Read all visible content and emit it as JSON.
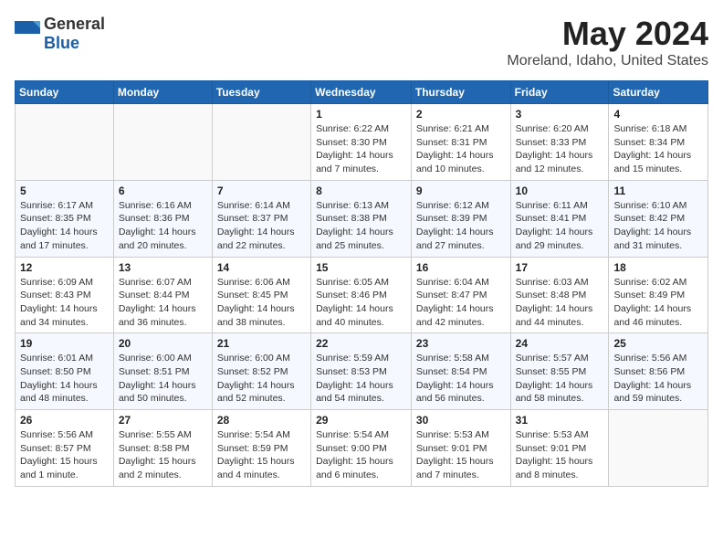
{
  "header": {
    "logo_general": "General",
    "logo_blue": "Blue",
    "title": "May 2024",
    "subtitle": "Moreland, Idaho, United States"
  },
  "days_of_week": [
    "Sunday",
    "Monday",
    "Tuesday",
    "Wednesday",
    "Thursday",
    "Friday",
    "Saturday"
  ],
  "weeks": [
    [
      {
        "num": "",
        "info": ""
      },
      {
        "num": "",
        "info": ""
      },
      {
        "num": "",
        "info": ""
      },
      {
        "num": "1",
        "info": "Sunrise: 6:22 AM\nSunset: 8:30 PM\nDaylight: 14 hours\nand 7 minutes."
      },
      {
        "num": "2",
        "info": "Sunrise: 6:21 AM\nSunset: 8:31 PM\nDaylight: 14 hours\nand 10 minutes."
      },
      {
        "num": "3",
        "info": "Sunrise: 6:20 AM\nSunset: 8:33 PM\nDaylight: 14 hours\nand 12 minutes."
      },
      {
        "num": "4",
        "info": "Sunrise: 6:18 AM\nSunset: 8:34 PM\nDaylight: 14 hours\nand 15 minutes."
      }
    ],
    [
      {
        "num": "5",
        "info": "Sunrise: 6:17 AM\nSunset: 8:35 PM\nDaylight: 14 hours\nand 17 minutes."
      },
      {
        "num": "6",
        "info": "Sunrise: 6:16 AM\nSunset: 8:36 PM\nDaylight: 14 hours\nand 20 minutes."
      },
      {
        "num": "7",
        "info": "Sunrise: 6:14 AM\nSunset: 8:37 PM\nDaylight: 14 hours\nand 22 minutes."
      },
      {
        "num": "8",
        "info": "Sunrise: 6:13 AM\nSunset: 8:38 PM\nDaylight: 14 hours\nand 25 minutes."
      },
      {
        "num": "9",
        "info": "Sunrise: 6:12 AM\nSunset: 8:39 PM\nDaylight: 14 hours\nand 27 minutes."
      },
      {
        "num": "10",
        "info": "Sunrise: 6:11 AM\nSunset: 8:41 PM\nDaylight: 14 hours\nand 29 minutes."
      },
      {
        "num": "11",
        "info": "Sunrise: 6:10 AM\nSunset: 8:42 PM\nDaylight: 14 hours\nand 31 minutes."
      }
    ],
    [
      {
        "num": "12",
        "info": "Sunrise: 6:09 AM\nSunset: 8:43 PM\nDaylight: 14 hours\nand 34 minutes."
      },
      {
        "num": "13",
        "info": "Sunrise: 6:07 AM\nSunset: 8:44 PM\nDaylight: 14 hours\nand 36 minutes."
      },
      {
        "num": "14",
        "info": "Sunrise: 6:06 AM\nSunset: 8:45 PM\nDaylight: 14 hours\nand 38 minutes."
      },
      {
        "num": "15",
        "info": "Sunrise: 6:05 AM\nSunset: 8:46 PM\nDaylight: 14 hours\nand 40 minutes."
      },
      {
        "num": "16",
        "info": "Sunrise: 6:04 AM\nSunset: 8:47 PM\nDaylight: 14 hours\nand 42 minutes."
      },
      {
        "num": "17",
        "info": "Sunrise: 6:03 AM\nSunset: 8:48 PM\nDaylight: 14 hours\nand 44 minutes."
      },
      {
        "num": "18",
        "info": "Sunrise: 6:02 AM\nSunset: 8:49 PM\nDaylight: 14 hours\nand 46 minutes."
      }
    ],
    [
      {
        "num": "19",
        "info": "Sunrise: 6:01 AM\nSunset: 8:50 PM\nDaylight: 14 hours\nand 48 minutes."
      },
      {
        "num": "20",
        "info": "Sunrise: 6:00 AM\nSunset: 8:51 PM\nDaylight: 14 hours\nand 50 minutes."
      },
      {
        "num": "21",
        "info": "Sunrise: 6:00 AM\nSunset: 8:52 PM\nDaylight: 14 hours\nand 52 minutes."
      },
      {
        "num": "22",
        "info": "Sunrise: 5:59 AM\nSunset: 8:53 PM\nDaylight: 14 hours\nand 54 minutes."
      },
      {
        "num": "23",
        "info": "Sunrise: 5:58 AM\nSunset: 8:54 PM\nDaylight: 14 hours\nand 56 minutes."
      },
      {
        "num": "24",
        "info": "Sunrise: 5:57 AM\nSunset: 8:55 PM\nDaylight: 14 hours\nand 58 minutes."
      },
      {
        "num": "25",
        "info": "Sunrise: 5:56 AM\nSunset: 8:56 PM\nDaylight: 14 hours\nand 59 minutes."
      }
    ],
    [
      {
        "num": "26",
        "info": "Sunrise: 5:56 AM\nSunset: 8:57 PM\nDaylight: 15 hours\nand 1 minute."
      },
      {
        "num": "27",
        "info": "Sunrise: 5:55 AM\nSunset: 8:58 PM\nDaylight: 15 hours\nand 2 minutes."
      },
      {
        "num": "28",
        "info": "Sunrise: 5:54 AM\nSunset: 8:59 PM\nDaylight: 15 hours\nand 4 minutes."
      },
      {
        "num": "29",
        "info": "Sunrise: 5:54 AM\nSunset: 9:00 PM\nDaylight: 15 hours\nand 6 minutes."
      },
      {
        "num": "30",
        "info": "Sunrise: 5:53 AM\nSunset: 9:01 PM\nDaylight: 15 hours\nand 7 minutes."
      },
      {
        "num": "31",
        "info": "Sunrise: 5:53 AM\nSunset: 9:01 PM\nDaylight: 15 hours\nand 8 minutes."
      },
      {
        "num": "",
        "info": ""
      }
    ]
  ]
}
